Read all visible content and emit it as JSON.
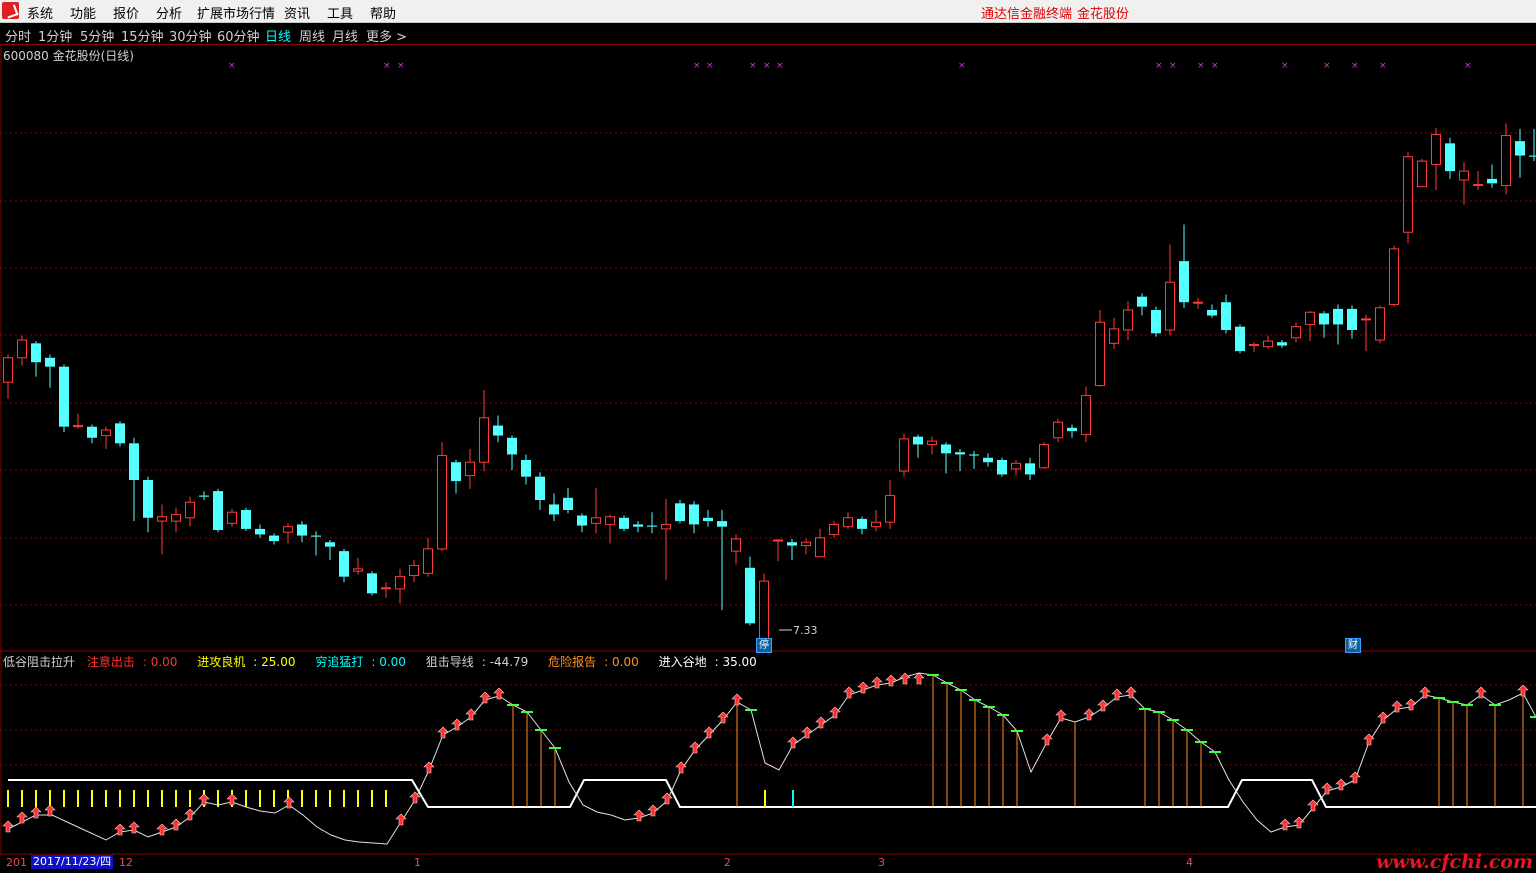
{
  "menu": {
    "items": [
      "系统",
      "功能",
      "报价",
      "分析",
      "扩展市场行情",
      "资讯",
      "工具",
      "帮助"
    ],
    "right_links": [
      "通达信金融终端",
      "金花股份"
    ]
  },
  "periods": {
    "items": [
      "分时",
      "1分钟",
      "5分钟",
      "15分钟",
      "30分钟",
      "60分钟",
      "日线",
      "周线",
      "月线",
      "更多 >"
    ],
    "active_index": 6
  },
  "stock": {
    "code_name": "600080 金花股份(日线)"
  },
  "price_panel": {
    "low_marker": "7.33",
    "badges": [
      "停",
      "财"
    ]
  },
  "indicator": {
    "name": "低谷阻击拉升",
    "fields": [
      {
        "label": "注意出击",
        "value": "0.00",
        "color": "#ff3333"
      },
      {
        "label": "进攻良机",
        "value": "25.00",
        "color": "#ffff00"
      },
      {
        "label": "穷追猛打",
        "value": "0.00",
        "color": "#00ffff"
      },
      {
        "label": "狙击导线",
        "value": "-44.79",
        "color": "#d0d0d0"
      },
      {
        "label": "危险报告",
        "value": "0.00",
        "color": "#ff9020"
      },
      {
        "label": "进入谷地",
        "value": "35.00",
        "color": "#ffffff"
      }
    ]
  },
  "date_axis": {
    "year_fragment": "201",
    "cursor_date": "2017/11/23/四",
    "month_labels": [
      "12",
      "1",
      "2",
      "3",
      "4"
    ]
  },
  "watermark": "www.cfchi.com",
  "colors": {
    "up": "#ff3c3c",
    "down": "#54ffff",
    "grid": "#8b0000",
    "magenta": "#cc33cc"
  },
  "chart_data": {
    "type": "candlestick",
    "title": "600080 金花股份(日线)",
    "candles": [
      [
        9.7,
        9.92,
        9.95,
        9.55
      ],
      [
        9.92,
        10.08,
        10.12,
        9.85
      ],
      [
        10.05,
        9.88,
        10.07,
        9.75
      ],
      [
        9.92,
        9.84,
        9.95,
        9.65
      ],
      [
        9.84,
        9.3,
        9.86,
        9.25
      ],
      [
        9.3,
        9.31,
        9.42,
        9.28
      ],
      [
        9.3,
        9.2,
        9.32,
        9.15
      ],
      [
        9.22,
        9.27,
        9.3,
        9.1
      ],
      [
        9.33,
        9.15,
        9.35,
        9.12
      ],
      [
        9.15,
        8.82,
        9.2,
        8.45
      ],
      [
        8.82,
        8.48,
        8.85,
        8.35
      ],
      [
        8.45,
        8.49,
        8.6,
        8.15
      ],
      [
        8.45,
        8.51,
        8.57,
        8.35
      ],
      [
        8.48,
        8.62,
        8.67,
        8.4
      ],
      [
        8.68,
        8.67,
        8.72,
        8.64
      ],
      [
        8.72,
        8.37,
        8.74,
        8.35
      ],
      [
        8.43,
        8.53,
        8.56,
        8.4
      ],
      [
        8.55,
        8.38,
        8.57,
        8.36
      ],
      [
        8.38,
        8.33,
        8.42,
        8.3
      ],
      [
        8.32,
        8.27,
        8.34,
        8.24
      ],
      [
        8.35,
        8.4,
        8.43,
        8.25
      ],
      [
        8.42,
        8.32,
        8.45,
        8.26
      ],
      [
        8.32,
        8.31,
        8.36,
        8.14
      ],
      [
        8.26,
        8.22,
        8.28,
        8.1
      ],
      [
        8.18,
        7.95,
        8.2,
        7.9
      ],
      [
        8.0,
        8.02,
        8.12,
        7.97
      ],
      [
        7.98,
        7.8,
        8.0,
        7.78
      ],
      [
        7.85,
        7.85,
        7.9,
        7.76
      ],
      [
        7.84,
        7.95,
        8.02,
        7.71
      ],
      [
        7.96,
        8.05,
        8.1,
        7.9
      ],
      [
        7.98,
        8.2,
        8.3,
        7.95
      ],
      [
        8.2,
        9.04,
        9.16,
        8.18
      ],
      [
        8.98,
        8.81,
        9.0,
        8.7
      ],
      [
        8.86,
        8.98,
        9.1,
        8.74
      ],
      [
        8.98,
        9.38,
        9.63,
        8.9
      ],
      [
        9.31,
        9.22,
        9.4,
        9.16
      ],
      [
        9.2,
        9.05,
        9.22,
        8.91
      ],
      [
        9.0,
        8.85,
        9.05,
        8.78
      ],
      [
        8.85,
        8.64,
        8.89,
        8.55
      ],
      [
        8.6,
        8.51,
        8.7,
        8.45
      ],
      [
        8.66,
        8.55,
        8.75,
        8.52
      ],
      [
        8.5,
        8.41,
        8.52,
        8.35
      ],
      [
        8.43,
        8.48,
        8.75,
        8.34
      ],
      [
        8.42,
        8.49,
        8.51,
        8.25
      ],
      [
        8.48,
        8.38,
        8.5,
        8.36
      ],
      [
        8.42,
        8.4,
        8.45,
        8.35
      ],
      [
        8.41,
        8.4,
        8.53,
        8.34
      ],
      [
        8.38,
        8.42,
        8.65,
        7.92
      ],
      [
        8.61,
        8.45,
        8.64,
        8.43
      ],
      [
        8.6,
        8.42,
        8.63,
        8.34
      ],
      [
        8.48,
        8.45,
        8.55,
        8.4
      ],
      [
        8.45,
        8.4,
        8.55,
        7.65
      ],
      [
        8.18,
        8.29,
        8.33,
        8.06
      ],
      [
        8.03,
        7.53,
        8.13,
        7.51
      ],
      [
        7.33,
        7.91,
        7.98,
        7.33
      ],
      [
        8.28,
        8.28,
        8.29,
        8.09
      ],
      [
        8.26,
        8.23,
        8.29,
        8.1
      ],
      [
        8.23,
        8.26,
        8.29,
        8.15
      ],
      [
        8.13,
        8.3,
        8.38,
        8.13
      ],
      [
        8.33,
        8.42,
        8.45,
        8.3
      ],
      [
        8.4,
        8.48,
        8.53,
        8.38
      ],
      [
        8.47,
        8.38,
        8.49,
        8.33
      ],
      [
        8.4,
        8.44,
        8.55,
        8.36
      ],
      [
        8.44,
        8.68,
        8.82,
        8.38
      ],
      [
        8.9,
        9.19,
        9.24,
        8.85
      ],
      [
        9.21,
        9.14,
        9.23,
        9.02
      ],
      [
        9.14,
        9.17,
        9.21,
        9.05
      ],
      [
        9.14,
        9.06,
        9.16,
        8.88
      ],
      [
        9.07,
        9.05,
        9.1,
        8.9
      ],
      [
        9.05,
        9.04,
        9.08,
        8.92
      ],
      [
        9.02,
        8.98,
        9.06,
        8.94
      ],
      [
        9.0,
        8.87,
        9.02,
        8.85
      ],
      [
        8.92,
        8.97,
        9.0,
        8.86
      ],
      [
        8.97,
        8.87,
        9.02,
        8.82
      ],
      [
        8.93,
        9.14,
        9.16,
        8.92
      ],
      [
        9.2,
        9.34,
        9.37,
        9.16
      ],
      [
        9.29,
        9.26,
        9.32,
        9.2
      ],
      [
        9.23,
        9.58,
        9.66,
        9.16
      ],
      [
        9.67,
        10.24,
        10.35,
        9.66
      ],
      [
        10.05,
        10.18,
        10.28,
        10.0
      ],
      [
        10.17,
        10.35,
        10.43,
        10.08
      ],
      [
        10.47,
        10.38,
        10.5,
        10.3
      ],
      [
        10.35,
        10.14,
        10.38,
        10.11
      ],
      [
        10.17,
        10.6,
        10.94,
        10.12
      ],
      [
        10.79,
        10.42,
        11.12,
        10.37
      ],
      [
        10.42,
        10.42,
        10.46,
        10.36
      ],
      [
        10.35,
        10.3,
        10.4,
        10.28
      ],
      [
        10.42,
        10.17,
        10.49,
        10.14
      ],
      [
        10.2,
        9.98,
        10.22,
        9.96
      ],
      [
        10.03,
        10.04,
        10.06,
        9.97
      ],
      [
        10.02,
        10.07,
        10.12,
        10.0
      ],
      [
        10.06,
        10.03,
        10.08,
        10.01
      ],
      [
        10.1,
        10.2,
        10.24,
        10.06
      ],
      [
        10.22,
        10.33,
        10.34,
        10.07
      ],
      [
        10.32,
        10.22,
        10.34,
        10.1
      ],
      [
        10.36,
        10.22,
        10.4,
        10.04
      ],
      [
        10.36,
        10.17,
        10.39,
        10.09
      ],
      [
        10.27,
        10.27,
        10.31,
        9.98
      ],
      [
        10.08,
        10.37,
        10.39,
        10.05
      ],
      [
        10.4,
        10.9,
        10.93,
        10.38
      ],
      [
        11.05,
        11.73,
        11.77,
        10.95
      ],
      [
        11.46,
        11.69,
        11.71,
        11.46
      ],
      [
        11.66,
        11.93,
        11.99,
        11.43
      ],
      [
        11.85,
        11.6,
        11.9,
        11.53
      ],
      [
        11.52,
        11.6,
        11.68,
        11.3
      ],
      [
        11.47,
        11.48,
        11.6,
        11.43
      ],
      [
        11.53,
        11.49,
        11.66,
        11.45
      ],
      [
        11.47,
        11.92,
        12.03,
        11.39
      ],
      [
        11.87,
        11.74,
        11.98,
        11.54
      ],
      [
        11.74,
        11.73,
        11.98,
        11.69
      ],
      [
        11.82,
        12.15,
        12.17,
        11.8
      ],
      [
        12.1,
        11.88,
        12.18,
        11.65
      ],
      [
        12.42,
        12.51,
        12.55,
        12.21
      ]
    ],
    "ylim": [
      7.2,
      12.6
    ]
  }
}
